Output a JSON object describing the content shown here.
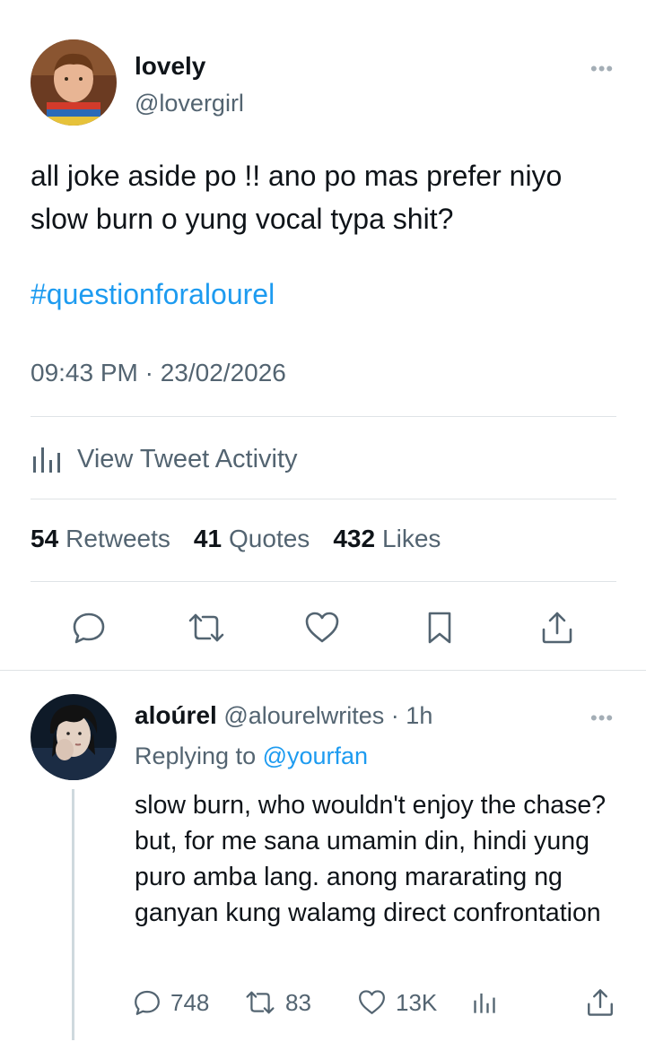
{
  "tweet": {
    "display_name": "lovely",
    "handle": "@lovergirl",
    "more_label": "•••",
    "text": "all joke aside po !! ano po mas prefer niyo slow burn o yung vocal typa shit?",
    "hashtag": "#questionforalourel",
    "timestamp": "09:43 PM · 23/02/2026",
    "activity_label": "View Tweet Activity",
    "stats": {
      "retweets_count": "54",
      "retweets_label": "Retweets",
      "quotes_count": "41",
      "quotes_label": "Quotes",
      "likes_count": "432",
      "likes_label": "Likes"
    },
    "actions": [
      "reply-icon",
      "retweet-icon",
      "like-icon",
      "bookmark-icon",
      "share-icon"
    ]
  },
  "reply": {
    "display_name": "aloúrel",
    "handle": "@alourelwrites",
    "separator": " · ",
    "time": "1h",
    "more_label": "•••",
    "replying_prefix": "Replying to",
    "replying_mention": "@yourfan",
    "text": "slow burn, who wouldn't enjoy the chase? but, for me sana umamin din, hindi yung puro amba lang. anong mararating ng ganyan kung walamg direct confrontation",
    "reply_count": "748",
    "retweet_count": "83",
    "like_count": "13K"
  },
  "colors": {
    "accent": "#1d9bf0",
    "secondary_text": "#536471",
    "divider": "#dfe3e6"
  }
}
